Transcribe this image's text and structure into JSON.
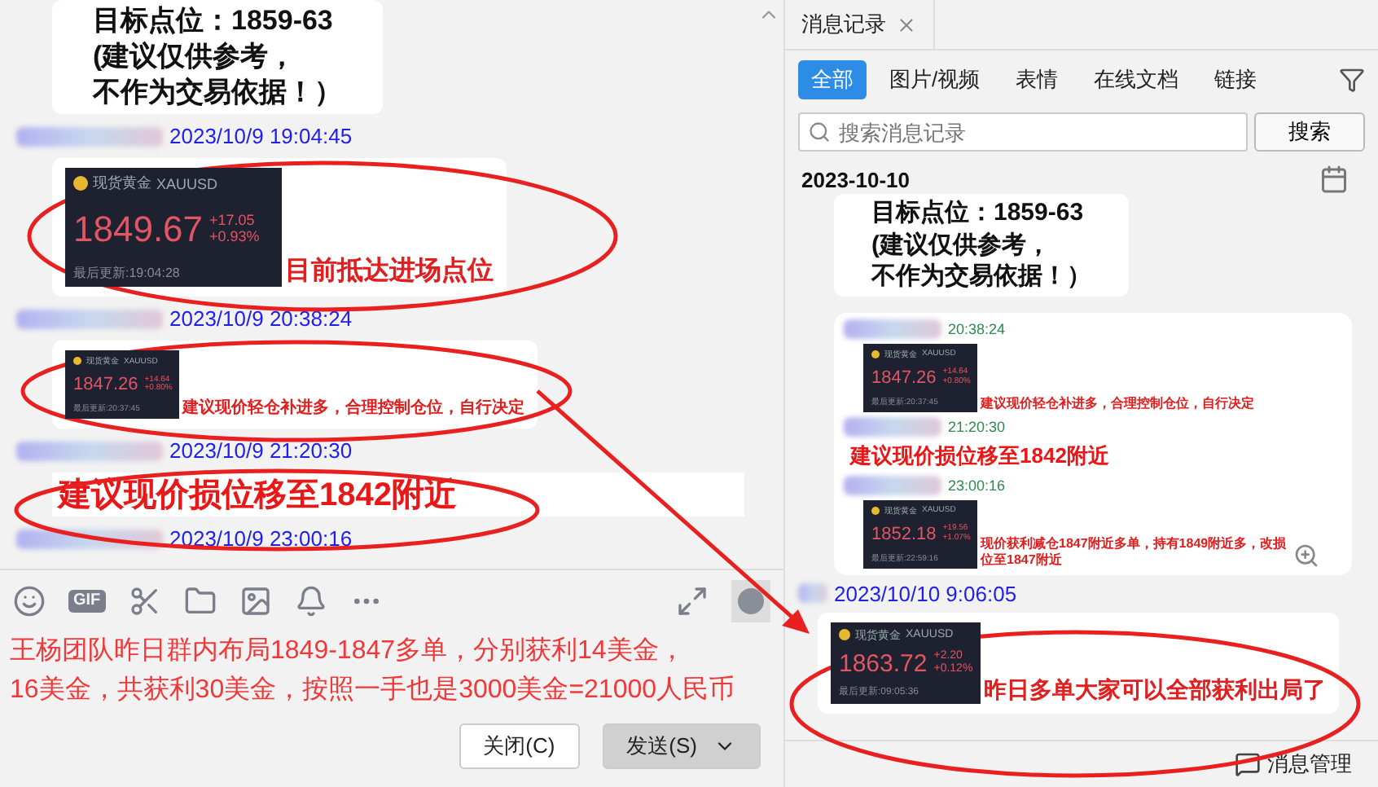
{
  "conversation": {
    "messages": [
      {
        "kind": "plain_text",
        "lines": [
          "目标点位：1859-63",
          "(建议仅供参考，",
          "不作为交易依据！）"
        ]
      },
      {
        "kind": "quote_card",
        "time": "2023/10/9 19:04:45",
        "card": {
          "name": "现货黄金",
          "symbol": "XAUUSD",
          "price": "1849.67",
          "change": "+17.05",
          "percent": "+0.93%",
          "updated": "最后更新:19:04:28"
        },
        "caption": "目前抵达进场点位"
      },
      {
        "kind": "quote_thumbnail",
        "time": "2023/10/9 20:38:24",
        "card": {
          "name": "现货黄金",
          "symbol": "XAUUSD",
          "price": "1847.26",
          "change": "+14.64",
          "percent": "+0.80%",
          "updated": "最后更新:20:37:45"
        },
        "caption": "建议现价轻仓补进多，合理控制仓位，自行决定"
      },
      {
        "kind": "alert_text",
        "time": "2023/10/9 21:20:30",
        "text": "建议现价损位移至1842附近"
      },
      {
        "kind": "cut_off",
        "time": "2023/10/9 23:00:16"
      }
    ]
  },
  "composer": {
    "gif_label": "GIF",
    "lines": [
      "王杨团队昨日群内布局1849-1847多单，分别获利14美金，",
      "16美金，共获利30美金，按照一手也是3000美金=21000人民币"
    ],
    "buttons": [
      {
        "label": "关闭(C)",
        "kind": "outline"
      },
      {
        "label": "发送(S)",
        "kind": "split"
      }
    ]
  },
  "history": {
    "title": "消息记录",
    "filters": [
      {
        "label": "全部",
        "selected": true
      },
      {
        "label": "图片/视频",
        "selected": false
      },
      {
        "label": "表情",
        "selected": false
      },
      {
        "label": "在线文档",
        "selected": false
      },
      {
        "label": "链接",
        "selected": false
      }
    ],
    "search": {
      "placeholder": "搜索消息记录",
      "button": "搜索"
    },
    "date": "2023-10-10",
    "messages": [
      {
        "kind": "plain_text",
        "lines": [
          "目标点位：1859-63",
          "(建议仅供参考，",
          "不作为交易依据！）"
        ]
      },
      {
        "kind": "forwarded",
        "items": [
          {
            "kind": "quote_thumbnail",
            "time": "20:38:24",
            "card": {
              "name": "现货黄金",
              "symbol": "XAUUSD",
              "price": "1847.26",
              "change": "+14.64",
              "percent": "+0.80%",
              "updated": "最后更新:20:37:45"
            },
            "caption": "建议现价轻仓补进多，合理控制仓位，自行决定"
          },
          {
            "kind": "alert_text",
            "time": "21:20:30",
            "text": "建议现价损位移至1842附近"
          },
          {
            "kind": "quote_thumbnail",
            "time": "23:00:16",
            "card": {
              "name": "现货黄金",
              "symbol": "XAUUSD",
              "price": "1852.18",
              "change": "+19.56",
              "percent": "+1.07%",
              "updated": "最后更新:22:59:16"
            },
            "caption": "现价获利减仓1847附近多单，持有1849附近多，改损位至1847附近"
          }
        ]
      },
      {
        "kind": "quote_card",
        "time": "2023/10/10 9:06:05",
        "card": {
          "name": "现货黄金",
          "symbol": "XAUUSD",
          "price": "1863.72",
          "change": "+2.20",
          "percent": "+0.12%",
          "updated": "最后更新:09:05:36"
        },
        "caption": "昨日多单大家可以全部获利出局了"
      }
    ],
    "footer": "消息管理"
  }
}
